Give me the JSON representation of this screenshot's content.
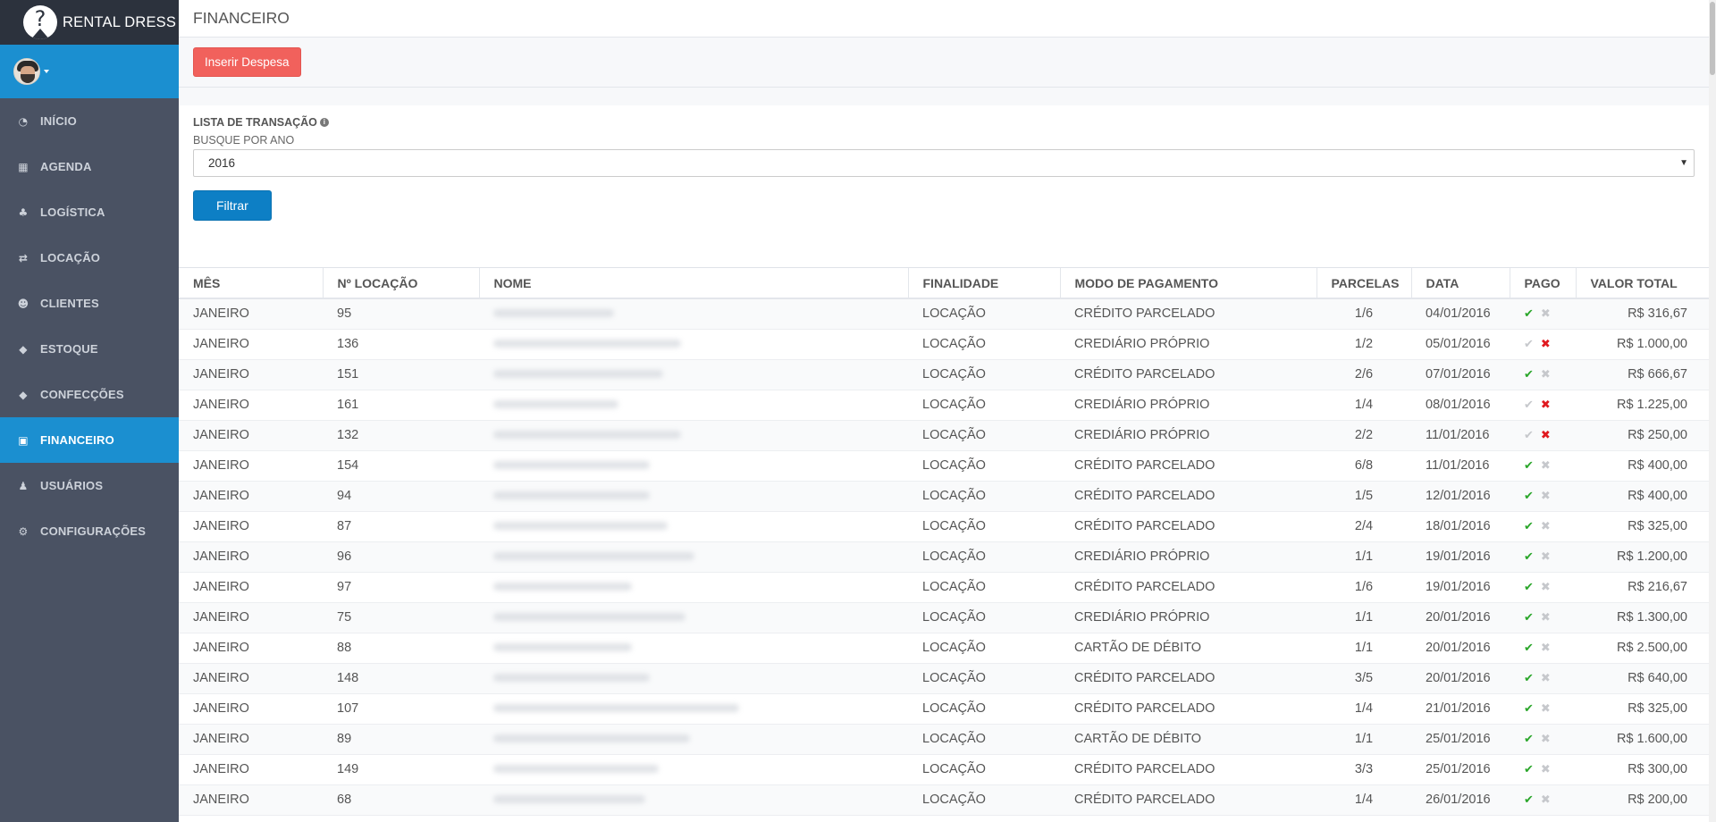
{
  "brand": {
    "name": "RENTAL DRESS"
  },
  "sidebar": {
    "items": [
      {
        "label": "INÍCIO",
        "icon": "dashboard-icon",
        "glyph": "◔"
      },
      {
        "label": "AGENDA",
        "icon": "calendar-icon",
        "glyph": "▦"
      },
      {
        "label": "LOGÍSTICA",
        "icon": "sitemap-icon",
        "glyph": "♣"
      },
      {
        "label": "LOCAÇÃO",
        "icon": "exchange-icon",
        "glyph": "⇄"
      },
      {
        "label": "CLIENTES",
        "icon": "users-icon",
        "glyph": "☻"
      },
      {
        "label": "ESTOQUE",
        "icon": "tag-icon",
        "glyph": "◆"
      },
      {
        "label": "CONFECÇÕES",
        "icon": "tag-icon",
        "glyph": "◆"
      },
      {
        "label": "FINANCEIRO",
        "icon": "money-icon",
        "glyph": "▣",
        "active": true
      },
      {
        "label": "USUÁRIOS",
        "icon": "user-icon",
        "glyph": "♟"
      },
      {
        "label": "CONFIGURAÇÕES",
        "icon": "cogs-icon",
        "glyph": "⚙"
      }
    ]
  },
  "header": {
    "title": "FINANCEIRO"
  },
  "toolbar": {
    "insert_label": "Inserir Despesa"
  },
  "filter": {
    "title": "LISTA DE TRANSAÇÃO",
    "label": "BUSQUE POR ANO",
    "year_value": "2016",
    "button_label": "Filtrar"
  },
  "table": {
    "columns": [
      "MÊS",
      "Nº LOCAÇÃO",
      "NOME",
      "FINALIDADE",
      "MODO DE PAGAMENTO",
      "PARCELAS",
      "DATA",
      "PAGO",
      "VALOR TOTAL"
    ],
    "rows": [
      {
        "mes": "JANEIRO",
        "locacao": "95",
        "finalidade": "LOCAÇÃO",
        "modo": "CRÉDITO PARCELADO",
        "parcelas": "1/6",
        "data": "04/01/2016",
        "pago": true,
        "valor": "R$ 316,67"
      },
      {
        "mes": "JANEIRO",
        "locacao": "136",
        "finalidade": "LOCAÇÃO",
        "modo": "CREDIÁRIO PRÓPRIO",
        "parcelas": "1/2",
        "data": "05/01/2016",
        "pago": false,
        "valor": "R$ 1.000,00"
      },
      {
        "mes": "JANEIRO",
        "locacao": "151",
        "finalidade": "LOCAÇÃO",
        "modo": "CRÉDITO PARCELADO",
        "parcelas": "2/6",
        "data": "07/01/2016",
        "pago": true,
        "valor": "R$ 666,67"
      },
      {
        "mes": "JANEIRO",
        "locacao": "161",
        "finalidade": "LOCAÇÃO",
        "modo": "CREDIÁRIO PRÓPRIO",
        "parcelas": "1/4",
        "data": "08/01/2016",
        "pago": false,
        "valor": "R$ 1.225,00"
      },
      {
        "mes": "JANEIRO",
        "locacao": "132",
        "finalidade": "LOCAÇÃO",
        "modo": "CREDIÁRIO PRÓPRIO",
        "parcelas": "2/2",
        "data": "11/01/2016",
        "pago": false,
        "valor": "R$ 250,00"
      },
      {
        "mes": "JANEIRO",
        "locacao": "154",
        "finalidade": "LOCAÇÃO",
        "modo": "CRÉDITO PARCELADO",
        "parcelas": "6/8",
        "data": "11/01/2016",
        "pago": true,
        "valor": "R$ 400,00"
      },
      {
        "mes": "JANEIRO",
        "locacao": "94",
        "finalidade": "LOCAÇÃO",
        "modo": "CRÉDITO PARCELADO",
        "parcelas": "1/5",
        "data": "12/01/2016",
        "pago": true,
        "valor": "R$ 400,00"
      },
      {
        "mes": "JANEIRO",
        "locacao": "87",
        "finalidade": "LOCAÇÃO",
        "modo": "CRÉDITO PARCELADO",
        "parcelas": "2/4",
        "data": "18/01/2016",
        "pago": true,
        "valor": "R$ 325,00"
      },
      {
        "mes": "JANEIRO",
        "locacao": "96",
        "finalidade": "LOCAÇÃO",
        "modo": "CREDIÁRIO PRÓPRIO",
        "parcelas": "1/1",
        "data": "19/01/2016",
        "pago": true,
        "valor": "R$ 1.200,00"
      },
      {
        "mes": "JANEIRO",
        "locacao": "97",
        "finalidade": "LOCAÇÃO",
        "modo": "CRÉDITO PARCELADO",
        "parcelas": "1/6",
        "data": "19/01/2016",
        "pago": true,
        "valor": "R$ 216,67"
      },
      {
        "mes": "JANEIRO",
        "locacao": "75",
        "finalidade": "LOCAÇÃO",
        "modo": "CREDIÁRIO PRÓPRIO",
        "parcelas": "1/1",
        "data": "20/01/2016",
        "pago": true,
        "valor": "R$ 1.300,00"
      },
      {
        "mes": "JANEIRO",
        "locacao": "88",
        "finalidade": "LOCAÇÃO",
        "modo": "CARTÃO DE DÉBITO",
        "parcelas": "1/1",
        "data": "20/01/2016",
        "pago": true,
        "valor": "R$ 2.500,00"
      },
      {
        "mes": "JANEIRO",
        "locacao": "148",
        "finalidade": "LOCAÇÃO",
        "modo": "CRÉDITO PARCELADO",
        "parcelas": "3/5",
        "data": "20/01/2016",
        "pago": true,
        "valor": "R$ 640,00"
      },
      {
        "mes": "JANEIRO",
        "locacao": "107",
        "finalidade": "LOCAÇÃO",
        "modo": "CRÉDITO PARCELADO",
        "parcelas": "1/4",
        "data": "21/01/2016",
        "pago": true,
        "valor": "R$ 325,00"
      },
      {
        "mes": "JANEIRO",
        "locacao": "89",
        "finalidade": "LOCAÇÃO",
        "modo": "CARTÃO DE DÉBITO",
        "parcelas": "1/1",
        "data": "25/01/2016",
        "pago": true,
        "valor": "R$ 1.600,00"
      },
      {
        "mes": "JANEIRO",
        "locacao": "149",
        "finalidade": "LOCAÇÃO",
        "modo": "CRÉDITO PARCELADO",
        "parcelas": "3/3",
        "data": "25/01/2016",
        "pago": true,
        "valor": "R$ 300,00"
      },
      {
        "mes": "JANEIRO",
        "locacao": "68",
        "finalidade": "LOCAÇÃO",
        "modo": "CRÉDITO PARCELADO",
        "parcelas": "1/4",
        "data": "26/01/2016",
        "pago": true,
        "valor": "R$ 200,00"
      }
    ]
  },
  "colors": {
    "sidebar_bg": "#4a5263",
    "brand_bg": "#2c323d",
    "accent_blue": "#1b8fd0",
    "danger": "#f1615c",
    "primary_button": "#0d7fc5",
    "paid_green": "#2aa62a",
    "unpaid_red": "#e0191f"
  }
}
